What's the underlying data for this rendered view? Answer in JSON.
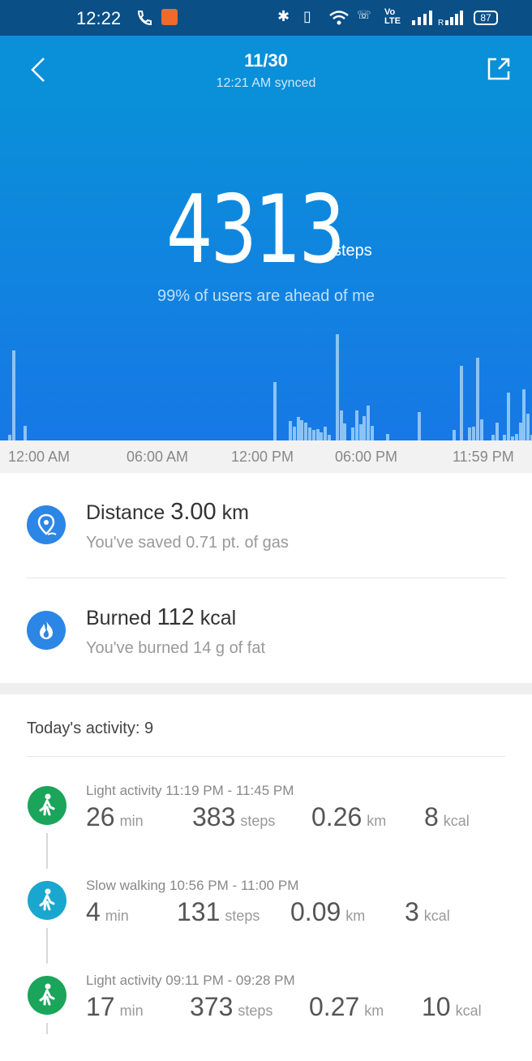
{
  "status_bar": {
    "time": "12:22",
    "battery": "87"
  },
  "header": {
    "date": "11/30",
    "synced": "12:21 AM synced"
  },
  "summary": {
    "steps": "4313",
    "steps_unit": "steps",
    "rank_text": "99% of users are ahead of me"
  },
  "chart_data": {
    "type": "bar",
    "x_ticks": [
      "12:00 AM",
      "06:00 AM",
      "12:00 PM",
      "06:00 PM",
      "11:59 PM"
    ],
    "values": [
      0.05,
      0.85,
      0,
      0,
      0.14,
      0,
      0,
      0,
      0,
      0,
      0,
      0,
      0,
      0,
      0,
      0,
      0,
      0,
      0,
      0,
      0,
      0,
      0,
      0,
      0,
      0,
      0,
      0,
      0,
      0,
      0,
      0,
      0,
      0,
      0,
      0,
      0,
      0,
      0,
      0,
      0,
      0,
      0,
      0,
      0,
      0,
      0,
      0,
      0,
      0,
      0,
      0,
      0,
      0,
      0,
      0,
      0,
      0,
      0,
      0,
      0,
      0,
      0,
      0,
      0,
      0,
      0,
      0,
      0.55,
      0,
      0,
      0,
      0.18,
      0.13,
      0.22,
      0.19,
      0.17,
      0.12,
      0.1,
      0.11,
      0.08,
      0.13,
      0.05,
      0,
      1.0,
      0.28,
      0.16,
      0,
      0.12,
      0.28,
      0.15,
      0.23,
      0.33,
      0.14,
      0,
      0,
      0,
      0.06,
      0,
      0,
      0,
      0,
      0,
      0,
      0,
      0.27,
      0,
      0,
      0,
      0,
      0,
      0,
      0,
      0,
      0.1,
      0,
      0.7,
      0,
      0.12,
      0.13,
      0.78,
      0.2,
      0,
      0,
      0.05,
      0.17,
      0,
      0.05,
      0.45,
      0.04,
      0.06,
      0.17,
      0.48,
      0.25,
      0.05
    ]
  },
  "distance": {
    "label": "Distance",
    "value": "3.00",
    "unit": "km",
    "sub": "You've saved 0.71 pt.  of gas"
  },
  "burned": {
    "label": "Burned",
    "value": "112",
    "unit": "kcal",
    "sub": "You've burned 14 g  of fat"
  },
  "activity": {
    "header": "Today's activity:  9",
    "items": [
      {
        "title": "Light activity 11:19 PM - 11:45 PM",
        "min": "26",
        "steps": "383",
        "km": "0.26",
        "kcal": "8",
        "color": "#1aa55a"
      },
      {
        "title": "Slow walking 10:56 PM - 11:00 PM",
        "min": "4",
        "steps": "131",
        "km": "0.09",
        "kcal": "3",
        "color": "#19a7cf"
      },
      {
        "title": "Light activity 09:11 PM - 09:28 PM",
        "min": "17",
        "steps": "373",
        "km": "0.27",
        "kcal": "10",
        "color": "#1aa55a"
      }
    ],
    "units": {
      "min": "min",
      "steps": "steps",
      "km": "km",
      "kcal": "kcal"
    }
  }
}
